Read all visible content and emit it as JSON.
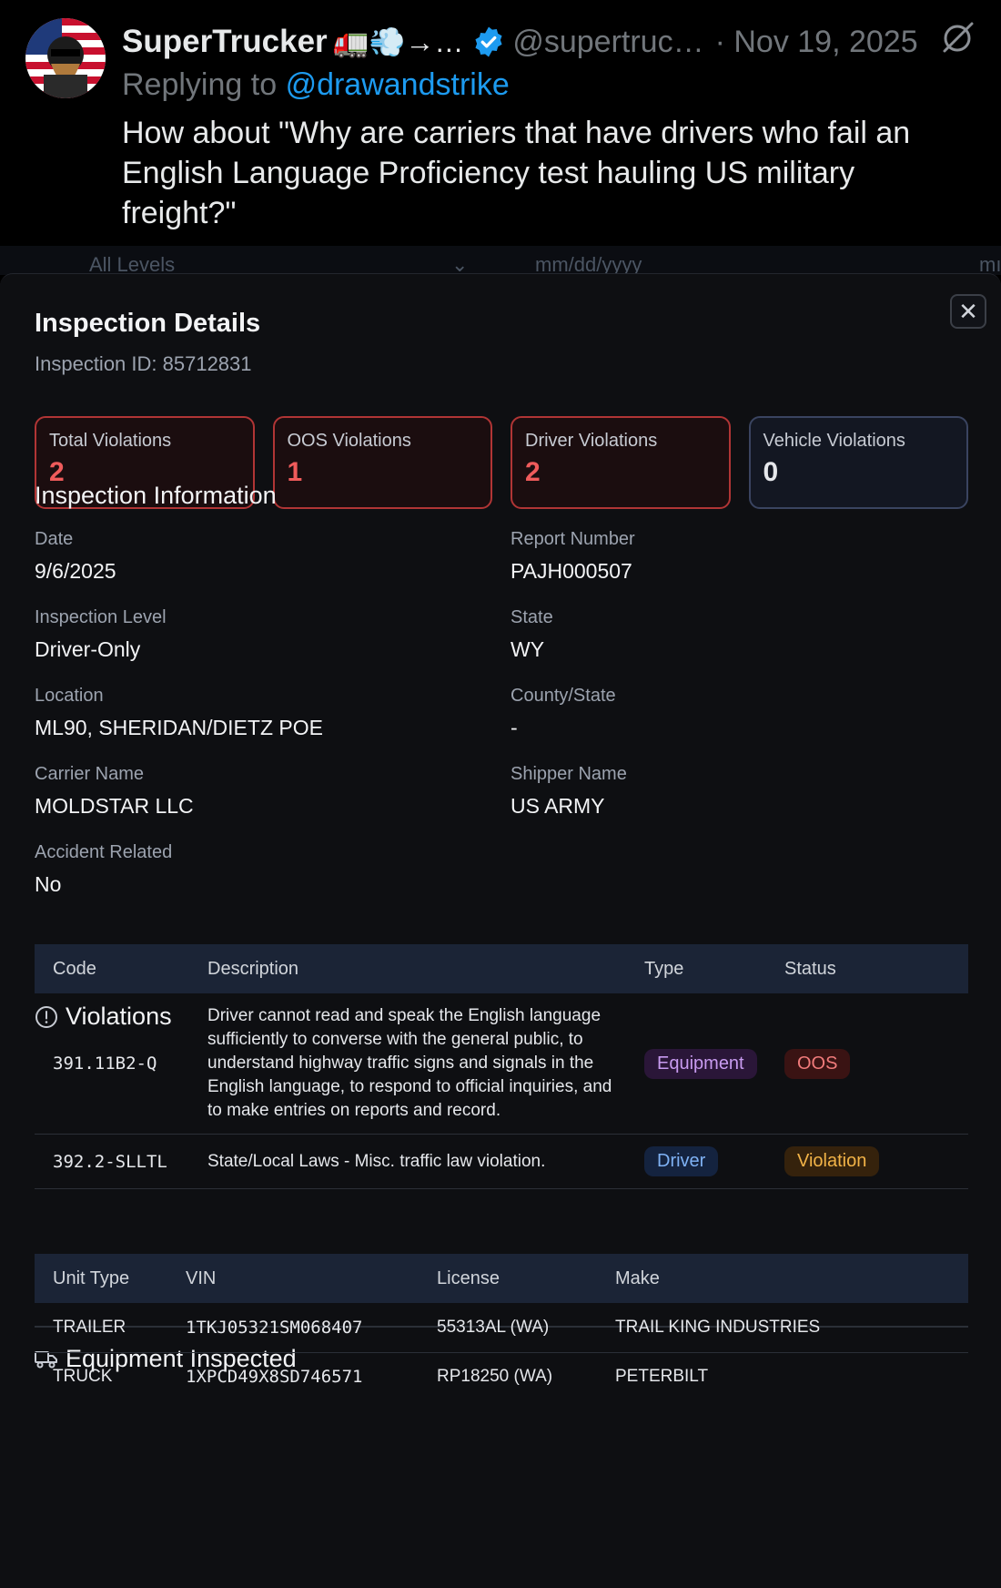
{
  "tweet": {
    "display_name": "SuperTrucker",
    "name_emojis": "🚛💨→…",
    "handle": "@supertruc…",
    "date": "· Nov 19, 2025",
    "replying_prefix": "Replying to",
    "replying_to": "@drawandstrike",
    "text": "How about \"Why are carriers that have drivers who fail an English Language Proficiency test hauling US military freight?\""
  },
  "background": {
    "level_select": "All Levels",
    "date_placeholder": "mm/dd/yyyy",
    "date_placeholder_2": "mı"
  },
  "modal": {
    "title": "Inspection Details",
    "inspection_id": "Inspection ID: 85712831",
    "close_glyph": "✕",
    "stats": [
      {
        "label": "Total Violations",
        "value": "2"
      },
      {
        "label": "OOS Violations",
        "value": "1"
      },
      {
        "label": "Driver Violations",
        "value": "2"
      },
      {
        "label": "Vehicle Violations",
        "value": "0"
      }
    ],
    "info_title": "Inspection Information",
    "info": {
      "date_label": "Date",
      "date": "9/6/2025",
      "report_label": "Report Number",
      "report": "PAJH000507",
      "level_label": "Inspection Level",
      "level": "Driver-Only",
      "state_label": "State",
      "state": "WY",
      "location_label": "Location",
      "location": "ML90, SHERIDAN/DIETZ POE",
      "county_label": "County/State",
      "county": "-",
      "carrier_label": "Carrier Name",
      "carrier": "MOLDSTAR LLC",
      "shipper_label": "Shipper Name",
      "shipper": "US ARMY",
      "accident_label": "Accident Related",
      "accident": "No"
    },
    "violations_title": "Violations",
    "violations_headers": {
      "code": "Code",
      "description": "Description",
      "type": "Type",
      "status": "Status"
    },
    "violations": [
      {
        "code": "391.11B2-Q",
        "description": "Driver cannot read and speak the English language sufficiently to converse with the general public, to understand highway traffic signs and signals in the English language, to respond to official inquiries, and to make entries on reports and record.",
        "type": "Equipment",
        "status": "OOS"
      },
      {
        "code": "392.2-SLLTL",
        "description": "State/Local Laws - Misc. traffic law violation.",
        "type": "Driver",
        "status": "Violation"
      }
    ],
    "equipment_title": "Equipment Inspected",
    "equipment_headers": {
      "unit": "Unit Type",
      "vin": "VIN",
      "license": "License",
      "make": "Make"
    },
    "equipment": [
      {
        "unit": "TRAILER",
        "vin": "1TKJ05321SM068407",
        "license": "55313AL (WA)",
        "make": "TRAIL KING INDUSTRIES"
      },
      {
        "unit": "TRUCK",
        "vin": "1XPCD49X8SD746571",
        "license": "RP18250 (WA)",
        "make": "PETERBILT"
      }
    ]
  },
  "colors": {
    "accent_blue": "#1d9bf0",
    "danger_red": "#ef5b5b",
    "warning_amber": "#f2b347",
    "background": "#000000"
  }
}
